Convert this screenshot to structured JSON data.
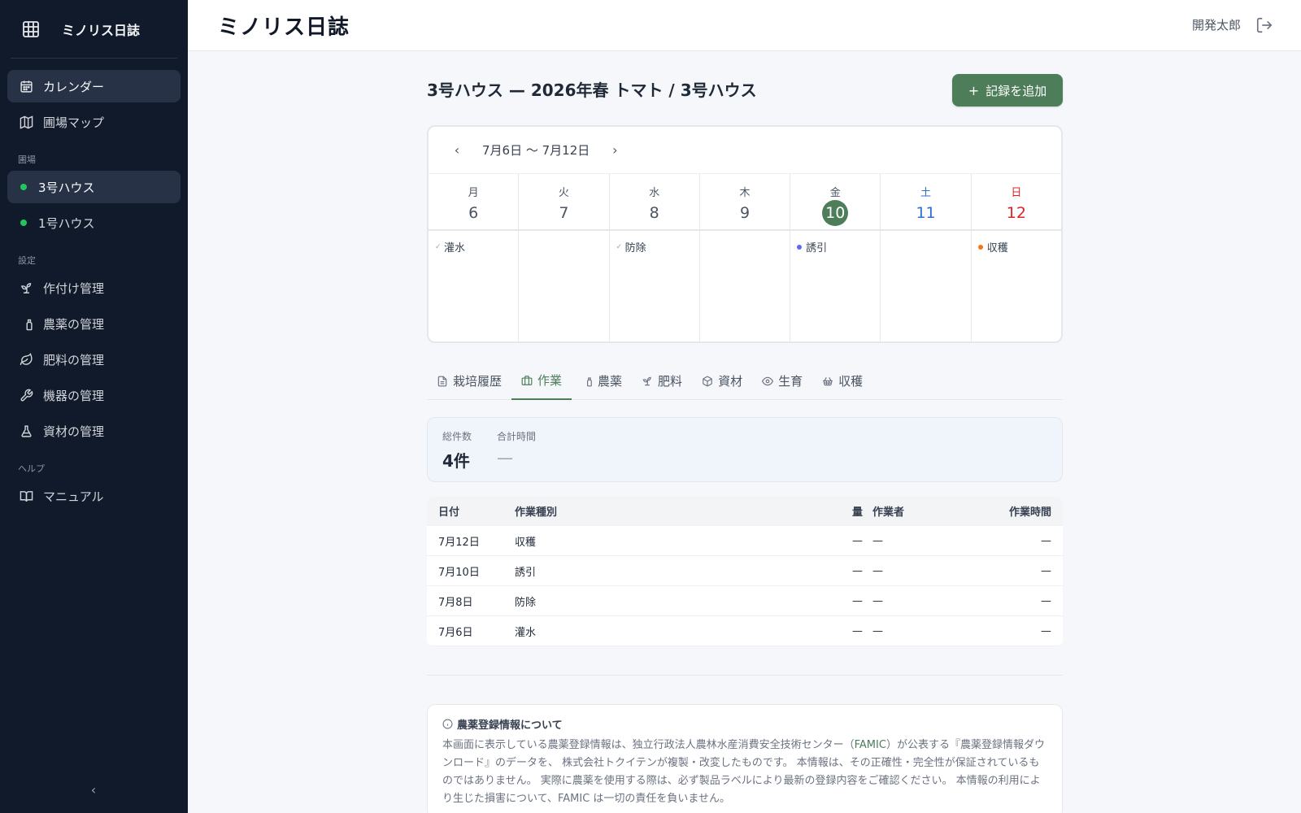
{
  "app": {
    "name": "ミノリス日誌"
  },
  "sidebar": {
    "main_items": [
      {
        "label": "カレンダー",
        "icon": "calendar-icon",
        "active": true
      },
      {
        "label": "圃場マップ",
        "icon": "map-icon",
        "active": false
      }
    ],
    "fields_section": "圃場",
    "fields": [
      {
        "label": "3号ハウス",
        "active": true
      },
      {
        "label": "1号ハウス",
        "active": false
      }
    ],
    "settings_section": "設定",
    "settings_items": [
      {
        "label": "作付け管理",
        "icon": "sprout-icon"
      },
      {
        "label": "農薬の管理",
        "icon": "spray-icon"
      },
      {
        "label": "肥料の管理",
        "icon": "leaf-icon"
      },
      {
        "label": "機器の管理",
        "icon": "wrench-icon"
      },
      {
        "label": "資材の管理",
        "icon": "flask-icon"
      }
    ],
    "help_section": "ヘルプ",
    "help_items": [
      {
        "label": "マニュアル",
        "icon": "book-icon"
      }
    ],
    "collapse_label": "‹"
  },
  "header": {
    "title": "ミノリス日誌",
    "user": "開発太郎"
  },
  "main": {
    "field_title": "3号ハウス — 2026年春 トマト / 3号ハウス",
    "add_button": "記録を追加",
    "calendar": {
      "prev": "‹",
      "next": "›",
      "range": "7月6日 〜 7月12日",
      "days": [
        {
          "dow": "月",
          "num": "6"
        },
        {
          "dow": "火",
          "num": "7"
        },
        {
          "dow": "水",
          "num": "8"
        },
        {
          "dow": "木",
          "num": "9"
        },
        {
          "dow": "金",
          "num": "10",
          "today": true
        },
        {
          "dow": "土",
          "num": "11"
        },
        {
          "dow": "日",
          "num": "12"
        }
      ],
      "events": [
        {
          "label": "灌水",
          "marker": "✓"
        },
        {
          "label": ""
        },
        {
          "label": "防除",
          "marker": "✓"
        },
        {
          "label": ""
        },
        {
          "label": "誘引",
          "color": "#6366f1"
        },
        {
          "label": ""
        },
        {
          "label": "収穫",
          "color": "#f97316"
        }
      ]
    },
    "tabs": [
      {
        "label": "栽培履歴",
        "icon": "document-icon"
      },
      {
        "label": "作業",
        "icon": "briefcase-icon",
        "active": true
      },
      {
        "label": "農薬",
        "icon": "spray-icon"
      },
      {
        "label": "肥料",
        "icon": "sprout-icon"
      },
      {
        "label": "資材",
        "icon": "box-icon"
      },
      {
        "label": "生育",
        "icon": "eye-icon"
      },
      {
        "label": "収穫",
        "icon": "basket-icon"
      }
    ],
    "summary": {
      "count_label": "総件数",
      "count_value": "4件",
      "time_label": "合計時間",
      "time_value": "—"
    },
    "table": {
      "headers": {
        "date": "日付",
        "type": "作業種別",
        "qty": "量",
        "worker": "作業者",
        "time": "作業時間"
      },
      "rows": [
        {
          "date": "7月12日",
          "type": "収穫",
          "qty": "—",
          "worker": "—",
          "time": "—"
        },
        {
          "date": "7月10日",
          "type": "誘引",
          "qty": "—",
          "worker": "—",
          "time": "—"
        },
        {
          "date": "7月8日",
          "type": "防除",
          "qty": "—",
          "worker": "—",
          "time": "—"
        },
        {
          "date": "7月6日",
          "type": "灌水",
          "qty": "—",
          "worker": "—",
          "time": "—"
        }
      ]
    },
    "notice": {
      "title": "農薬登録情報について",
      "body_1": "本画面に表示している農薬登録情報は、独立行政法人農林水産消費安全技術センター（",
      "famic": "FAMIC",
      "body_2": "）が公表する『農薬登録情報ダウンロード』のデータを、 株式会社トクイテンが複製・改変したものです。 本情報は、その正確性・完全性が保証されているものではありません。 実際に農薬を使用する際は、必ず製品ラベルにより最新の登録内容をご確認ください。 本情報の利用により生じた損害について、FAMIC は一切の責任を負いません。"
    }
  },
  "colors": {
    "sidebar_bg": "#111a2b",
    "accent": "#4e7d5a",
    "field_dot": "#22c55e",
    "saturday": "#2f6fd6",
    "sunday": "#dc2626"
  }
}
